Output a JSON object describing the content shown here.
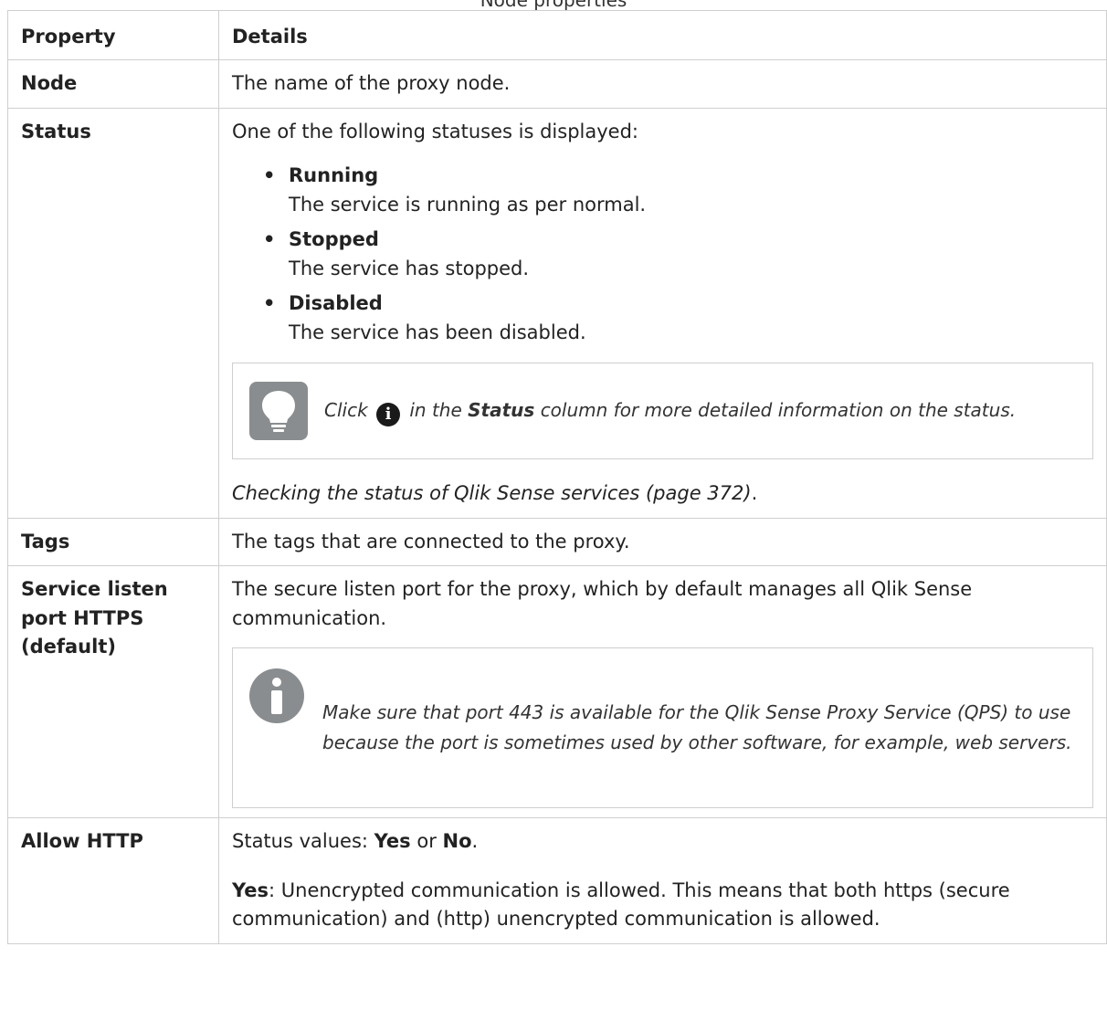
{
  "caption": "Node properties",
  "table": {
    "headers": {
      "property": "Property",
      "details": "Details"
    },
    "rows": {
      "node": {
        "property": "Node",
        "details": "The name of the proxy node."
      },
      "status": {
        "property": "Status",
        "intro": "One of the following statuses is displayed:",
        "items": [
          {
            "title": "Running",
            "desc": "The service is running as per normal."
          },
          {
            "title": "Stopped",
            "desc": "The service has stopped."
          },
          {
            "title": "Disabled",
            "desc": "The service has been disabled."
          }
        ],
        "tip": {
          "pre": "Click",
          "mid": "in the",
          "bold": "Status",
          "post": "column for more detailed information on the status.",
          "icon": "lightbulb-icon"
        },
        "link": "Checking the status of Qlik Sense services (page 372)",
        "link_suffix": "."
      },
      "tags": {
        "property": "Tags",
        "details": "The tags that are connected to the proxy."
      },
      "https": {
        "property_line1": "Service listen",
        "property_line2": "port HTTPS",
        "property_line3": "(default)",
        "details": "The secure listen port for the proxy, which by default manages all Qlik Sense communication.",
        "note": "Make sure that port 443 is available for the Qlik Sense Proxy Service (QPS) to use because the port is sometimes used by other software, for example, web servers."
      },
      "http": {
        "property": "Allow HTTP",
        "values_prefix": "Status values: ",
        "yes": "Yes",
        "or": " or ",
        "no": "No",
        "values_suffix": ".",
        "yes_label": "Yes",
        "yes_text": ": Unencrypted communication is allowed. This means that both https (secure communication) and (http) unencrypted communication is allowed."
      }
    }
  },
  "colors": {
    "border": "#cfcfcf",
    "icon_gray": "#8a8d8f",
    "text": "#222222"
  }
}
